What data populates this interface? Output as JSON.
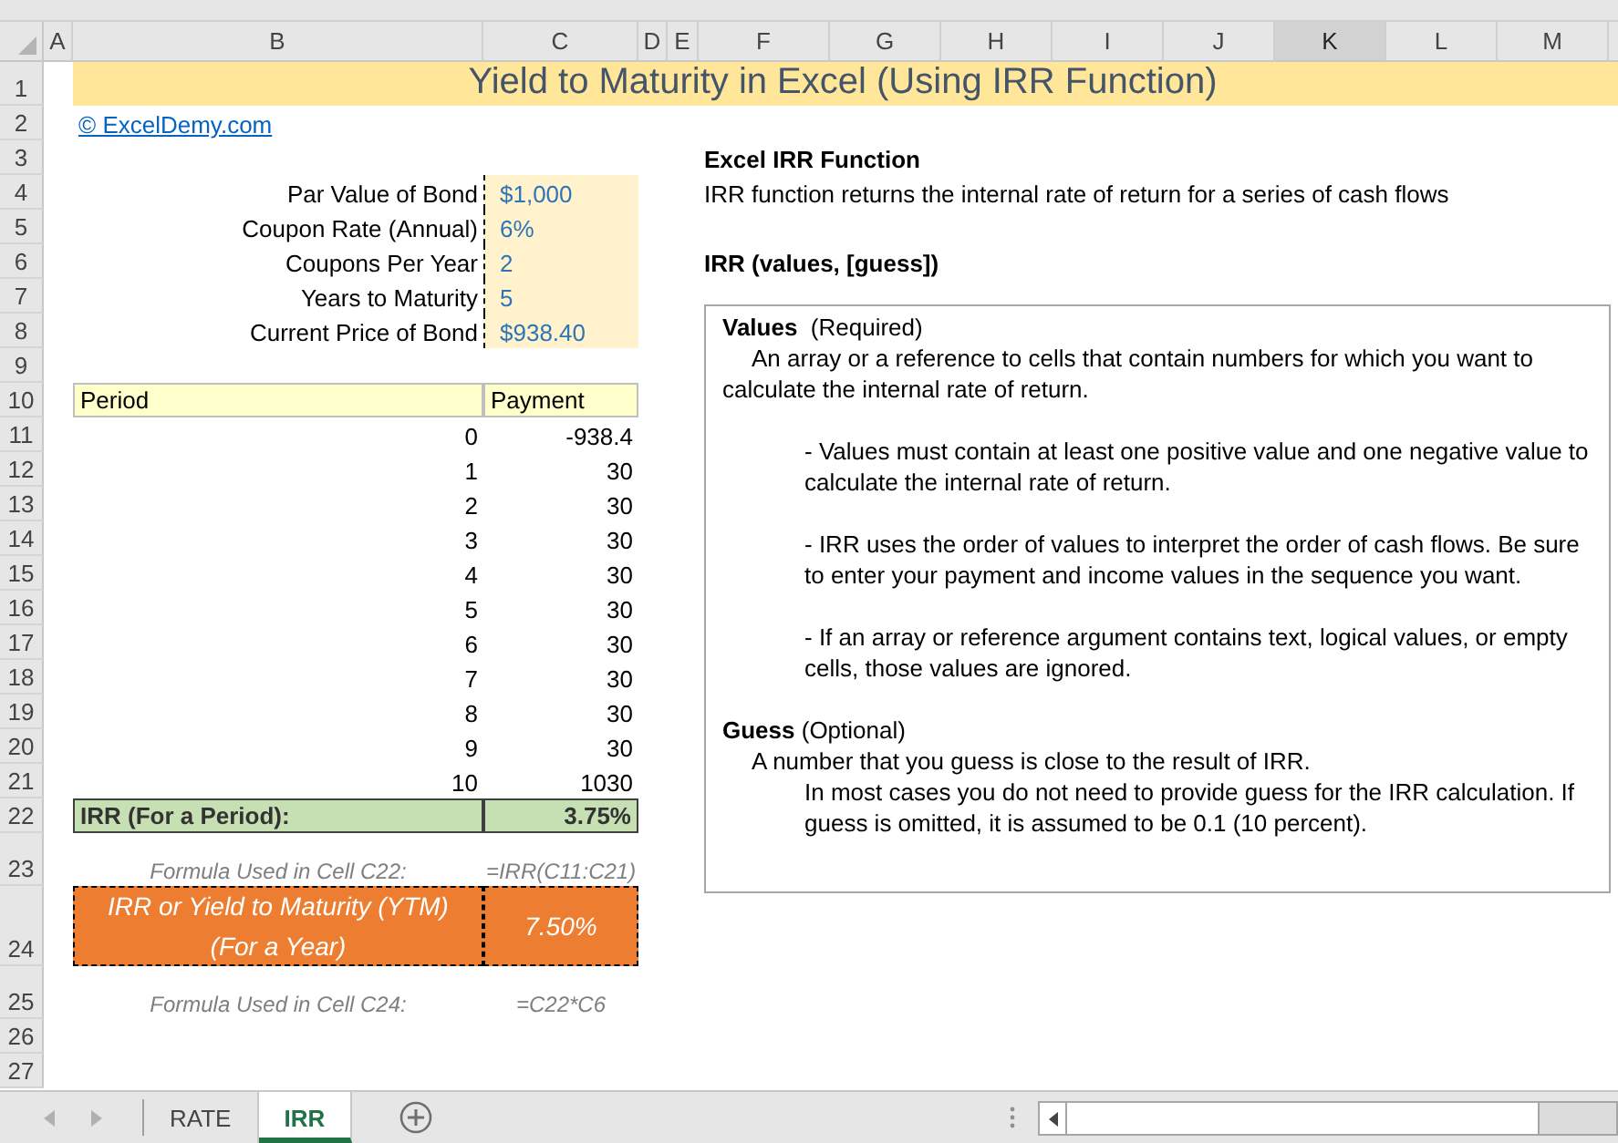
{
  "columns": [
    {
      "label": "A",
      "selected": false
    },
    {
      "label": "B",
      "selected": false
    },
    {
      "label": "C",
      "selected": false
    },
    {
      "label": "D",
      "selected": false
    },
    {
      "label": "E",
      "selected": false
    },
    {
      "label": "F",
      "selected": false
    },
    {
      "label": "G",
      "selected": false
    },
    {
      "label": "H",
      "selected": false
    },
    {
      "label": "I",
      "selected": false
    },
    {
      "label": "J",
      "selected": false
    },
    {
      "label": "K",
      "selected": true
    },
    {
      "label": "L",
      "selected": false
    },
    {
      "label": "M",
      "selected": false
    }
  ],
  "row_numbers": [
    "1",
    "2",
    "3",
    "4",
    "5",
    "6",
    "7",
    "8",
    "9",
    "10",
    "11",
    "12",
    "13",
    "14",
    "15",
    "16",
    "17",
    "18",
    "19",
    "20",
    "21",
    "22",
    "23",
    "24",
    "25",
    "26",
    "27"
  ],
  "title": "Yield to Maturity in Excel (Using IRR Function)",
  "link": "© ExcelDemy.com",
  "inputs": [
    {
      "label": "Par Value of Bond",
      "value": "$1,000"
    },
    {
      "label": "Coupon Rate (Annual)",
      "value": "6%"
    },
    {
      "label": "Coupons Per Year",
      "value": "2"
    },
    {
      "label": "Years to Maturity",
      "value": "5"
    },
    {
      "label": "Current Price of Bond",
      "value": "$938.40"
    }
  ],
  "cash_flow_table": {
    "columns": [
      "Period",
      "Payment"
    ],
    "rows": [
      [
        "0",
        "-938.4"
      ],
      [
        "1",
        "30"
      ],
      [
        "2",
        "30"
      ],
      [
        "3",
        "30"
      ],
      [
        "4",
        "30"
      ],
      [
        "5",
        "30"
      ],
      [
        "6",
        "30"
      ],
      [
        "7",
        "30"
      ],
      [
        "8",
        "30"
      ],
      [
        "9",
        "30"
      ],
      [
        "10",
        "1030"
      ]
    ]
  },
  "irr_row": {
    "label": "IRR (For a Period):",
    "value": "3.75%"
  },
  "irr_formula": {
    "label": "Formula Used in Cell C22:",
    "value": "=IRR(C11:C21)"
  },
  "ytm_row": {
    "label": "IRR or Yield to Maturity (YTM) (For a Year)",
    "value": "7.50%"
  },
  "ytm_formula": {
    "label": "Formula Used in Cell C24:",
    "value": "=C22*C6"
  },
  "function_info": {
    "heading": "Excel IRR Function",
    "description": "IRR function returns the internal rate of return for a series of cash flows",
    "syntax": "IRR (values, [guess])"
  },
  "text_box": [
    {
      "kind": "heading",
      "text": "**Values**  (Required)"
    },
    {
      "kind": "lead",
      "text": "An array or a reference to cells that contain numbers for which you want to calculate the internal rate of return."
    },
    {
      "kind": "bullet",
      "text": "- Values must contain at least one positive value and one negative value to calculate the internal rate of return."
    },
    {
      "kind": "bullet",
      "text": "- IRR uses the order of values to interpret the order of cash flows. Be sure to enter your payment and income values in the sequence you want."
    },
    {
      "kind": "bullet",
      "text": "- If an array or reference argument contains text, logical values, or empty cells, those values are ignored."
    },
    {
      "kind": "heading",
      "text": "**Guess** (Optional)"
    },
    {
      "kind": "lead",
      "text": "A number that you guess is close to the result of IRR."
    },
    {
      "kind": "note",
      "text": "In most cases you do not need to provide guess for the IRR calculation. If guess is omitted, it is assumed to be 0.1 (10 percent)."
    }
  ],
  "sheet_tabs": [
    {
      "label": "RATE",
      "selected": false
    },
    {
      "label": "IRR",
      "selected": true
    }
  ]
}
